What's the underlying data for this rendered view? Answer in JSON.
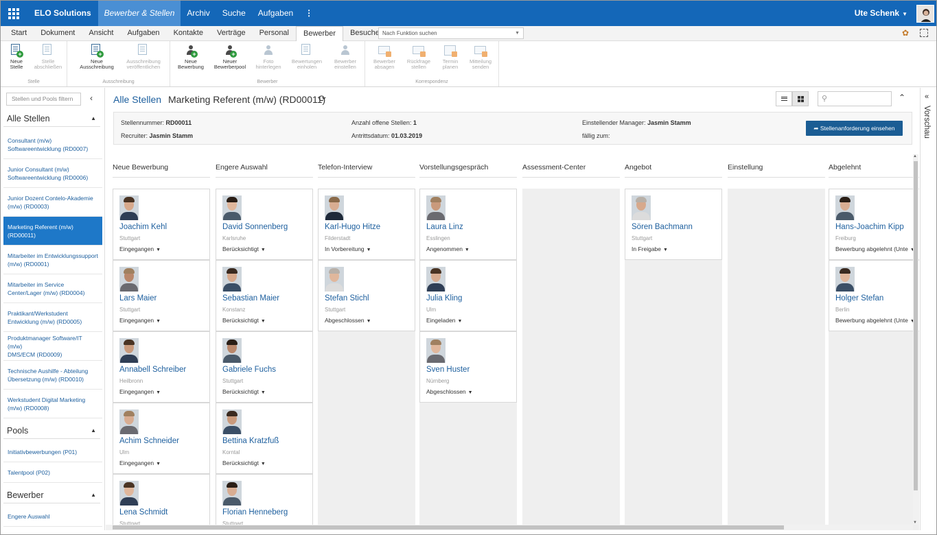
{
  "topbar": {
    "brand": "ELO Solutions",
    "nav": [
      "Bewerber & Stellen",
      "Archiv",
      "Suche",
      "Aufgaben"
    ],
    "user": "Ute Schenk"
  },
  "ribbon_tabs": [
    "Start",
    "Dokument",
    "Ansicht",
    "Aufgaben",
    "Kontakte",
    "Verträge",
    "Personal",
    "Bewerber",
    "Besucher"
  ],
  "function_search_placeholder": "Nach Funktion suchen",
  "ribbon": {
    "groups": {
      "stelle": "Stelle",
      "ausschreibung": "Ausschreibung",
      "bewerber": "Bewerber",
      "korrespondenz": "Korrespondenz"
    },
    "buttons": {
      "neue_stelle": [
        "Neue",
        "Stelle"
      ],
      "stelle_abschliessen": [
        "Stelle",
        "abschließen"
      ],
      "neue_ausschreibung": [
        "Neue",
        "Ausschreibung"
      ],
      "ausschreibung_veroeffentlichen": [
        "Ausschreibung",
        "veröffentlichen"
      ],
      "neue_bewerbung": [
        "Neue",
        "Bewerbung"
      ],
      "neuer_bewerberpool": [
        "Neuer",
        "Bewerberpool"
      ],
      "foto_hinterlegen": [
        "Foto",
        "hinterlegen"
      ],
      "bewertungen_einholen": [
        "Bewertungen",
        "einholen"
      ],
      "bewerber_einstellen": [
        "Bewerber",
        "einstellen"
      ],
      "bewerber_absagen": [
        "Bewerber",
        "absagen"
      ],
      "rueckfrage_stellen": [
        "Rückfrage",
        "stellen"
      ],
      "termin_planen": [
        "Termin",
        "planen"
      ],
      "mitteilung_senden": [
        "Mitteilung",
        "senden"
      ]
    }
  },
  "sidebar": {
    "filter_placeholder": "Stellen und Pools filtern",
    "sections": {
      "stellen": "Alle Stellen",
      "pools": "Pools",
      "bewerber": "Bewerber"
    },
    "stellen": [
      [
        "Consultant (m/w)",
        "Softwareentwicklung (RD0007)"
      ],
      [
        "Junior Consultant (m/w)",
        "Softwareentwicklung (RD0006)"
      ],
      [
        "Junior Dozent Contelo-Akademie",
        "(m/w) (RD0003)"
      ],
      [
        "Marketing Referent (m/w)",
        "(RD00011)"
      ],
      [
        "Mitarbeiter im Entwicklungssupport",
        "(m/w) (RD0001)"
      ],
      [
        "Mitarbeiter im Service",
        "Center/Lager (m/w) (RD0004)"
      ],
      [
        "Praktikant/Werkstudent",
        "Entwicklung (m/w) (RD0005)"
      ],
      [
        "Produktmanager Software/IT (m/w)",
        "DMS/ECM (RD0009)"
      ],
      [
        "Technische Aushilfe - Abteilung",
        "Übersetzung (m/w) (RD0010)"
      ],
      [
        "Werkstudent Digital Marketing",
        "(m/w) (RD0008)"
      ]
    ],
    "pools": [
      "Initiativbewerbungen (P01)",
      "Talentpool (P02)"
    ],
    "bewerber": [
      "Engere Auswahl"
    ]
  },
  "breadcrumb": {
    "root": "Alle Stellen",
    "current": "Marketing Referent (m/w) (RD00011)"
  },
  "info": {
    "stellennummer_label": "Stellennummer:",
    "stellennummer": "RD00011",
    "recruiter_label": "Recruiter:",
    "recruiter": "Jasmin Stamm",
    "offene_label": "Anzahl offene Stellen:",
    "offene": "1",
    "antritt_label": "Antrittsdatum:",
    "antritt": "01.03.2019",
    "manager_label": "Einstellender Manager:",
    "manager": "Jasmin Stamm",
    "faellig_label": "fällig zum:",
    "button": "Stellenanforderung einsehen"
  },
  "columns": [
    {
      "title": "Neue Bewerbung",
      "cards": [
        {
          "name": "Joachim Kehl",
          "city": "Stuttgart",
          "status": "Eingegangen"
        },
        {
          "name": "Lars Maier",
          "city": "Stuttgart",
          "status": "Eingegangen"
        },
        {
          "name": "Annabell Schreiber",
          "city": "Heilbronn",
          "status": "Eingegangen"
        },
        {
          "name": "Achim Schneider",
          "city": "Ulm",
          "status": "Eingegangen"
        },
        {
          "name": "Lena Schmidt",
          "city": "Stuttgart",
          "status": ""
        }
      ]
    },
    {
      "title": "Engere Auswahl",
      "cards": [
        {
          "name": "David Sonnenberg",
          "city": "Karlsruhe",
          "status": "Berücksichtigt"
        },
        {
          "name": "Sebastian Maier",
          "city": "Konstanz",
          "status": "Berücksichtigt"
        },
        {
          "name": "Gabriele Fuchs",
          "city": "Stuttgart",
          "status": "Berücksichtigt"
        },
        {
          "name": "Bettina Kratzfuß",
          "city": "Korntal",
          "status": "Berücksichtigt"
        },
        {
          "name": "Florian Henneberg",
          "city": "Stuttgart",
          "status": ""
        }
      ]
    },
    {
      "title": "Telefon-Interview",
      "cards": [
        {
          "name": "Karl-Hugo Hitze",
          "city": "Filderstadt",
          "status": "In Vorbereitung"
        },
        {
          "name": "Stefan Stichl",
          "city": "Stuttgart",
          "status": "Abgeschlossen"
        }
      ]
    },
    {
      "title": "Vorstellungsgespräch",
      "cards": [
        {
          "name": "Laura Linz",
          "city": "Esslingen",
          "status": "Angenommen"
        },
        {
          "name": "Julia Kling",
          "city": "Ulm",
          "status": "Eingeladen"
        },
        {
          "name": "Sven Huster",
          "city": "Nürnberg",
          "status": "Abgeschlossen"
        }
      ]
    },
    {
      "title": "Assessment-Center",
      "cards": []
    },
    {
      "title": "Angebot",
      "cards": [
        {
          "name": "Sören Bachmann",
          "city": "Stuttgart",
          "status": "In Freigabe"
        }
      ]
    },
    {
      "title": "Einstellung",
      "cards": []
    },
    {
      "title": "Abgelehnt",
      "cards": [
        {
          "name": "Hans-Joachim Kipp",
          "city": "Freiburg",
          "status": "Bewerbung abgelehnt (Unte"
        },
        {
          "name": "Holger Stefan",
          "city": "Berlin",
          "status": "Bewerbung abgelehnt (Unte"
        }
      ]
    }
  ],
  "rightrail": {
    "label": "Vorschau"
  }
}
